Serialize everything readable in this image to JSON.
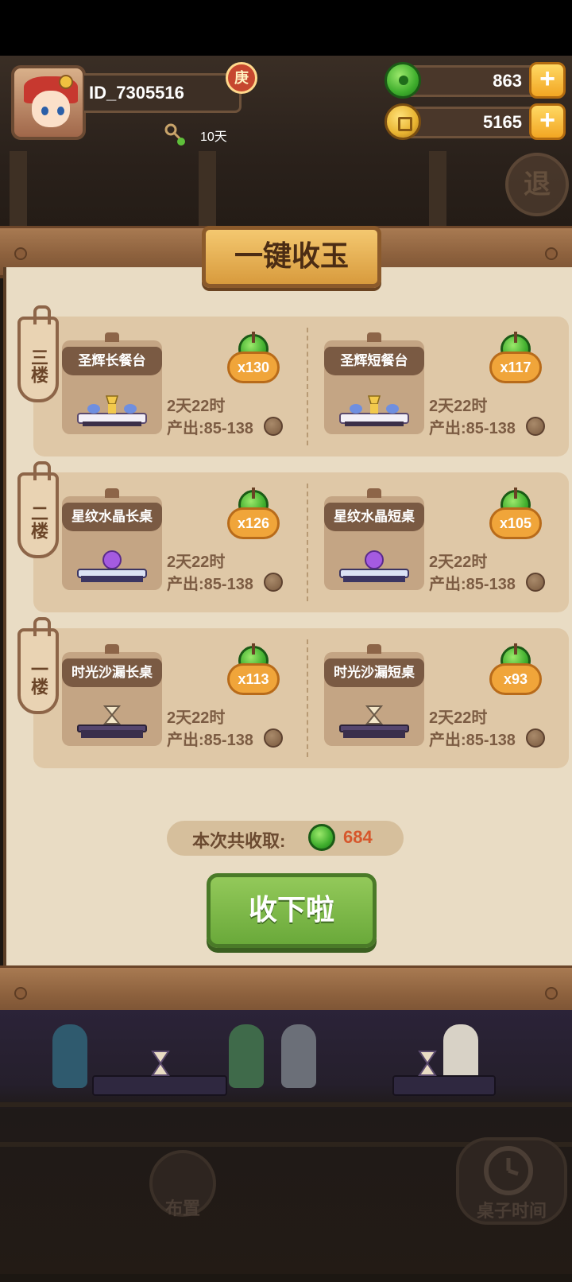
{
  "player": {
    "id": "ID_7305516",
    "rank_badge": "庚",
    "days": "10天"
  },
  "resources": {
    "jade": "863",
    "coins": "5165"
  },
  "exit_label": "退",
  "panel": {
    "title": "一键收玉",
    "floors": [
      {
        "label": "三楼",
        "items": [
          {
            "name": "圣辉长餐台",
            "count": "x130",
            "time": "2天22时",
            "output": "产出:85-138"
          },
          {
            "name": "圣辉短餐台",
            "count": "x117",
            "time": "2天22时",
            "output": "产出:85-138"
          }
        ]
      },
      {
        "label": "二楼",
        "items": [
          {
            "name": "星纹水晶长桌",
            "count": "x126",
            "time": "2天22时",
            "output": "产出:85-138"
          },
          {
            "name": "星纹水晶短桌",
            "count": "x105",
            "time": "2天22时",
            "output": "产出:85-138"
          }
        ]
      },
      {
        "label": "一楼",
        "items": [
          {
            "name": "时光沙漏长桌",
            "count": "x113",
            "time": "2天22时",
            "output": "产出:85-138"
          },
          {
            "name": "时光沙漏短桌",
            "count": "x93",
            "time": "2天22时",
            "output": "产出:85-138"
          }
        ]
      }
    ],
    "total_label": "本次共收取:",
    "total_value": "684",
    "confirm_label": "收下啦"
  },
  "bottom": {
    "layout_label": "布置",
    "table_time_label": "桌子时间"
  },
  "colors": {
    "jade": "#3fae2d",
    "gold": "#f2a623",
    "panel_bg": "#e9dcc4",
    "accent_red": "#d6572c"
  }
}
